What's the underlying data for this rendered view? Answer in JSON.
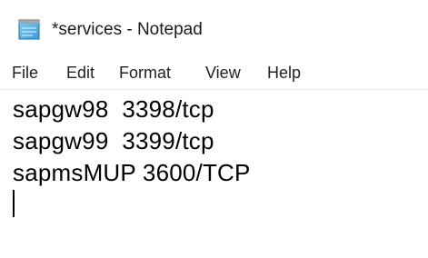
{
  "window": {
    "title": "*services - Notepad",
    "icon": "notepad-icon"
  },
  "menu": {
    "items": [
      "File",
      "Edit",
      "Format",
      "View",
      "Help"
    ]
  },
  "editor": {
    "lines": [
      "sapgw98  3398/tcp",
      "sapgw99  3399/tcp",
      "sapmsMUP 3600/TCP"
    ]
  }
}
